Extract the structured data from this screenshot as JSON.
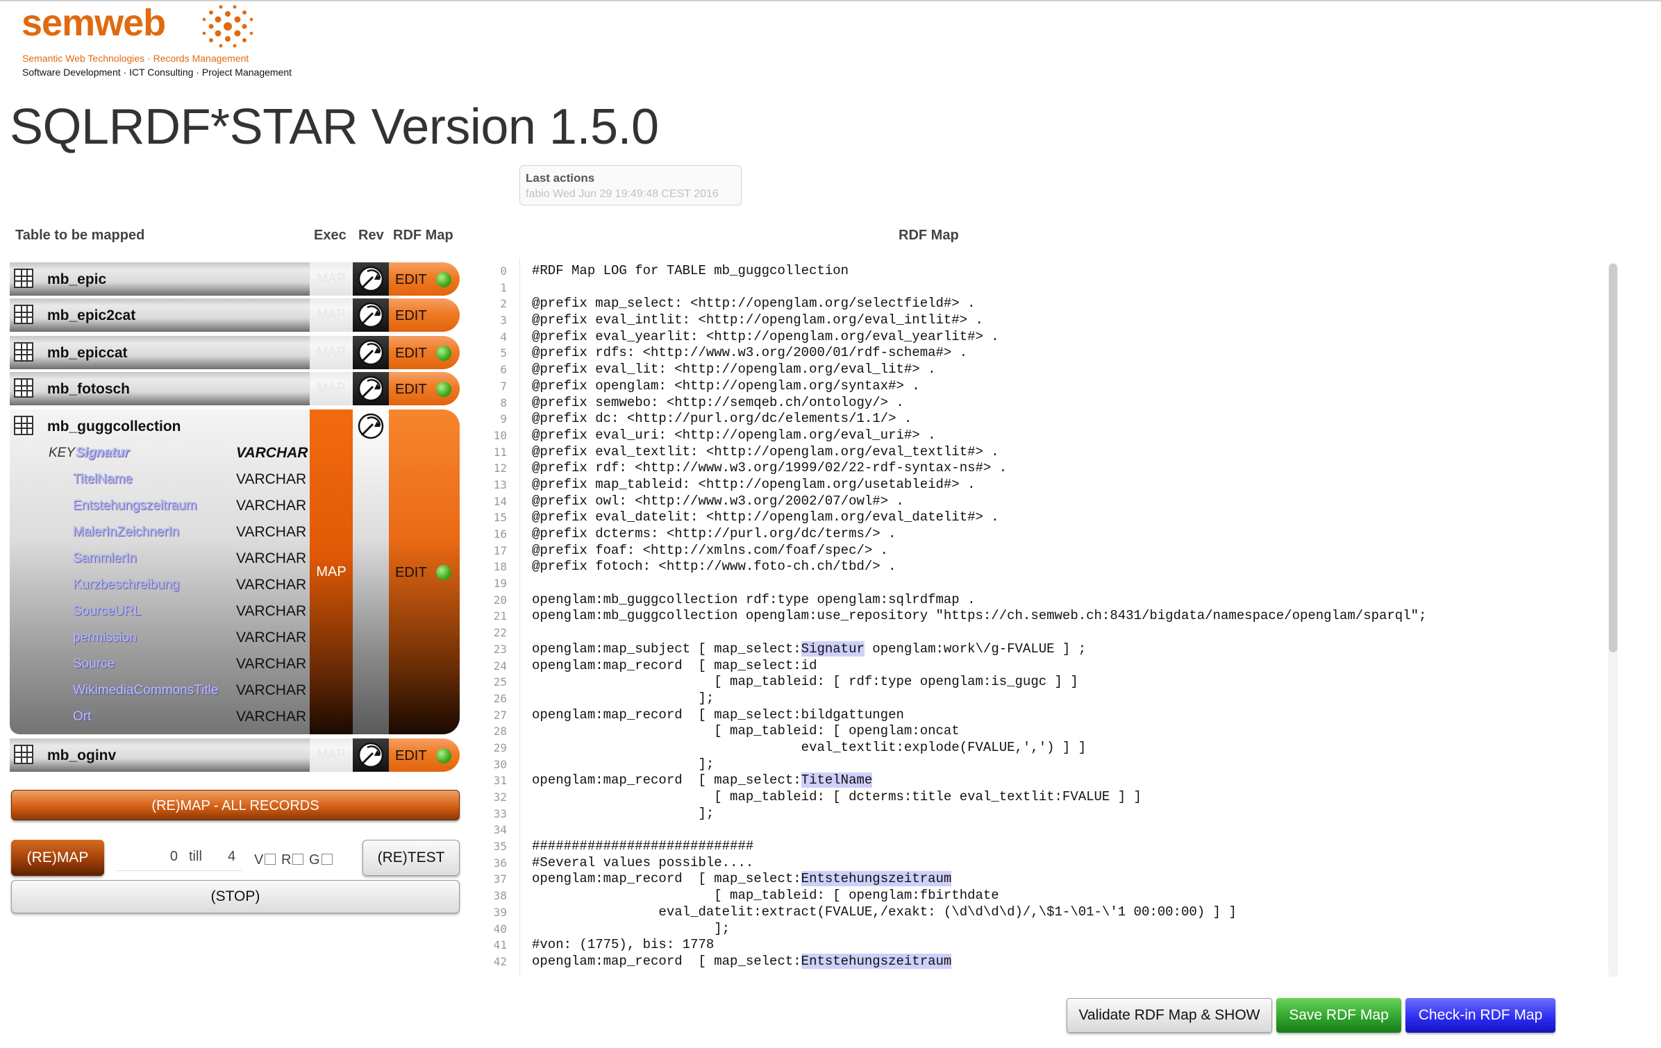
{
  "brand": {
    "name": "semweb",
    "tagline_1": "Semantic Web Technologies · Records Management",
    "tagline_2": "Software Development · ICT Consulting · Project Management",
    "accent": "#e06a10"
  },
  "app": {
    "title": "SQLRDF*STAR Version 1.5.0"
  },
  "last_actions": {
    "title": "Last actions",
    "text": "fabio Wed Jun 29 19:49:48 CEST 2016"
  },
  "table_panel": {
    "header_table": "Table to be mapped",
    "header_exec": "Exec",
    "header_rev": "Rev",
    "header_rdfmap": "RDF Map",
    "exec_label": "MAP",
    "edit_label": "EDIT",
    "tables": [
      {
        "name": "mb_epic",
        "status": "green"
      },
      {
        "name": "mb_epic2cat",
        "status": "none"
      },
      {
        "name": "mb_epiccat",
        "status": "green"
      },
      {
        "name": "mb_fotosch",
        "status": "green"
      },
      {
        "name": "mb_guggcollection",
        "status": "green"
      },
      {
        "name": "mb_oginv",
        "status": "green"
      }
    ],
    "expanded": {
      "key_label": "KEY",
      "fields": [
        {
          "name": "Signatur",
          "type": "VARCHAR"
        },
        {
          "name": "TitelName",
          "type": "VARCHAR"
        },
        {
          "name": "Entstehungszeitraum",
          "type": "VARCHAR"
        },
        {
          "name": "MalerInZeichnerIn",
          "type": "VARCHAR"
        },
        {
          "name": "SammlerIn",
          "type": "VARCHAR"
        },
        {
          "name": "Kurzbeschreibung",
          "type": "VARCHAR"
        },
        {
          "name": "SourceURL",
          "type": "VARCHAR"
        },
        {
          "name": "permission",
          "type": "VARCHAR"
        },
        {
          "name": "Source",
          "type": "VARCHAR"
        },
        {
          "name": "WikimediaCommonsTitle",
          "type": "VARCHAR"
        },
        {
          "name": "Ort",
          "type": "VARCHAR"
        }
      ]
    }
  },
  "controls": {
    "remap_all": "(RE)MAP - ALL RECORDS",
    "remap": "(RE)MAP",
    "range_from": "0",
    "range_till": "till",
    "range_to": "4",
    "flag_v": "V",
    "flag_r": "R",
    "flag_g": "G",
    "retest": "(RE)TEST",
    "stop": "(STOP)"
  },
  "rdf_panel": {
    "header": "RDF Map",
    "lines": [
      [
        {
          "t": "#RDF Map LOG for TABLE mb_guggcollection"
        }
      ],
      [
        {
          "t": ""
        }
      ],
      [
        {
          "t": "@prefix map_select: <http://openglam.org/selectfield#> ."
        }
      ],
      [
        {
          "t": "@prefix eval_intlit: <http://openglam.org/eval_intlit#> ."
        }
      ],
      [
        {
          "t": "@prefix eval_yearlit: <http://openglam.org/eval_yearlit#> ."
        }
      ],
      [
        {
          "t": "@prefix rdfs: <http://www.w3.org/2000/01/rdf-schema#> ."
        }
      ],
      [
        {
          "t": "@prefix eval_lit: <http://openglam.org/eval_lit#> ."
        }
      ],
      [
        {
          "t": "@prefix openglam: <http://openglam.org/syntax#> ."
        }
      ],
      [
        {
          "t": "@prefix semwebo: <http://semqeb.ch/ontology/> ."
        }
      ],
      [
        {
          "t": "@prefix dc: <http://purl.org/dc/elements/1.1/> ."
        }
      ],
      [
        {
          "t": "@prefix eval_uri: <http://openglam.org/eval_uri#> ."
        }
      ],
      [
        {
          "t": "@prefix eval_textlit: <http://openglam.org/eval_textlit#> ."
        }
      ],
      [
        {
          "t": "@prefix rdf: <http://www.w3.org/1999/02/22-rdf-syntax-ns#> ."
        }
      ],
      [
        {
          "t": "@prefix map_tableid: <http://openglam.org/usetableid#> ."
        }
      ],
      [
        {
          "t": "@prefix owl: <http://www.w3.org/2002/07/owl#> ."
        }
      ],
      [
        {
          "t": "@prefix eval_datelit: <http://openglam.org/eval_datelit#> ."
        }
      ],
      [
        {
          "t": "@prefix dcterms: <http://purl.org/dc/terms/> ."
        }
      ],
      [
        {
          "t": "@prefix foaf: <http://xmlns.com/foaf/spec/> ."
        }
      ],
      [
        {
          "t": "@prefix fotoch: <http://www.foto-ch.ch/tbd/> ."
        }
      ],
      [
        {
          "t": ""
        }
      ],
      [
        {
          "t": "openglam:mb_guggcollection rdf:type openglam:sqlrdfmap ."
        }
      ],
      [
        {
          "t": "openglam:mb_guggcollection openglam:use_repository \"https://ch.semweb.ch:8431/bigdata/namespace/openglam/sparql\";"
        }
      ],
      [
        {
          "t": ""
        }
      ],
      [
        {
          "t": "openglam:map_subject [ map_select:"
        },
        {
          "t": "Signatur",
          "h": true
        },
        {
          "t": " openglam:work\\/g-FVALUE ] ;"
        }
      ],
      [
        {
          "t": "openglam:map_record  [ map_select:id"
        }
      ],
      [
        {
          "t": "                       [ map_tableid: [ rdf:type openglam:is_gugc ] ]"
        }
      ],
      [
        {
          "t": "                     ];"
        }
      ],
      [
        {
          "t": "openglam:map_record  [ map_select:bildgattungen"
        }
      ],
      [
        {
          "t": "                       [ map_tableid: [ openglam:oncat"
        }
      ],
      [
        {
          "t": "                                  eval_textlit:explode(FVALUE,',') ] ]"
        }
      ],
      [
        {
          "t": "                     ];"
        }
      ],
      [
        {
          "t": "openglam:map_record  [ map_select:"
        },
        {
          "t": "TitelName",
          "h": true
        }
      ],
      [
        {
          "t": "                       [ map_tableid: [ dcterms:title eval_textlit:FVALUE ] ]"
        }
      ],
      [
        {
          "t": "                     ];"
        }
      ],
      [
        {
          "t": ""
        }
      ],
      [
        {
          "t": "############################"
        }
      ],
      [
        {
          "t": "#Several values possible...."
        }
      ],
      [
        {
          "t": "openglam:map_record  [ map_select:"
        },
        {
          "t": "Entstehungszeitraum",
          "h": true
        }
      ],
      [
        {
          "t": "                       [ map_tableid: [ openglam:fbirthdate"
        }
      ],
      [
        {
          "t": "                eval_datelit:extract(FVALUE,/exakt: (\\d\\d\\d\\d)/,\\$1-\\01-\\'1 00:00:00) ] ]"
        }
      ],
      [
        {
          "t": "                       ];"
        }
      ],
      [
        {
          "t": "#von: (1775), bis: 1778"
        }
      ],
      [
        {
          "t": "openglam:map_record  [ map_select:"
        },
        {
          "t": "Entstehungszeitraum",
          "h": true
        }
      ]
    ],
    "highlight_color": "#cfd0fa"
  },
  "actions": {
    "validate": "Validate RDF Map & SHOW",
    "save": "Save RDF Map",
    "checkin": "Check-in RDF Map",
    "save_color": "#2ea02a",
    "checkin_color": "#2a2af0"
  }
}
